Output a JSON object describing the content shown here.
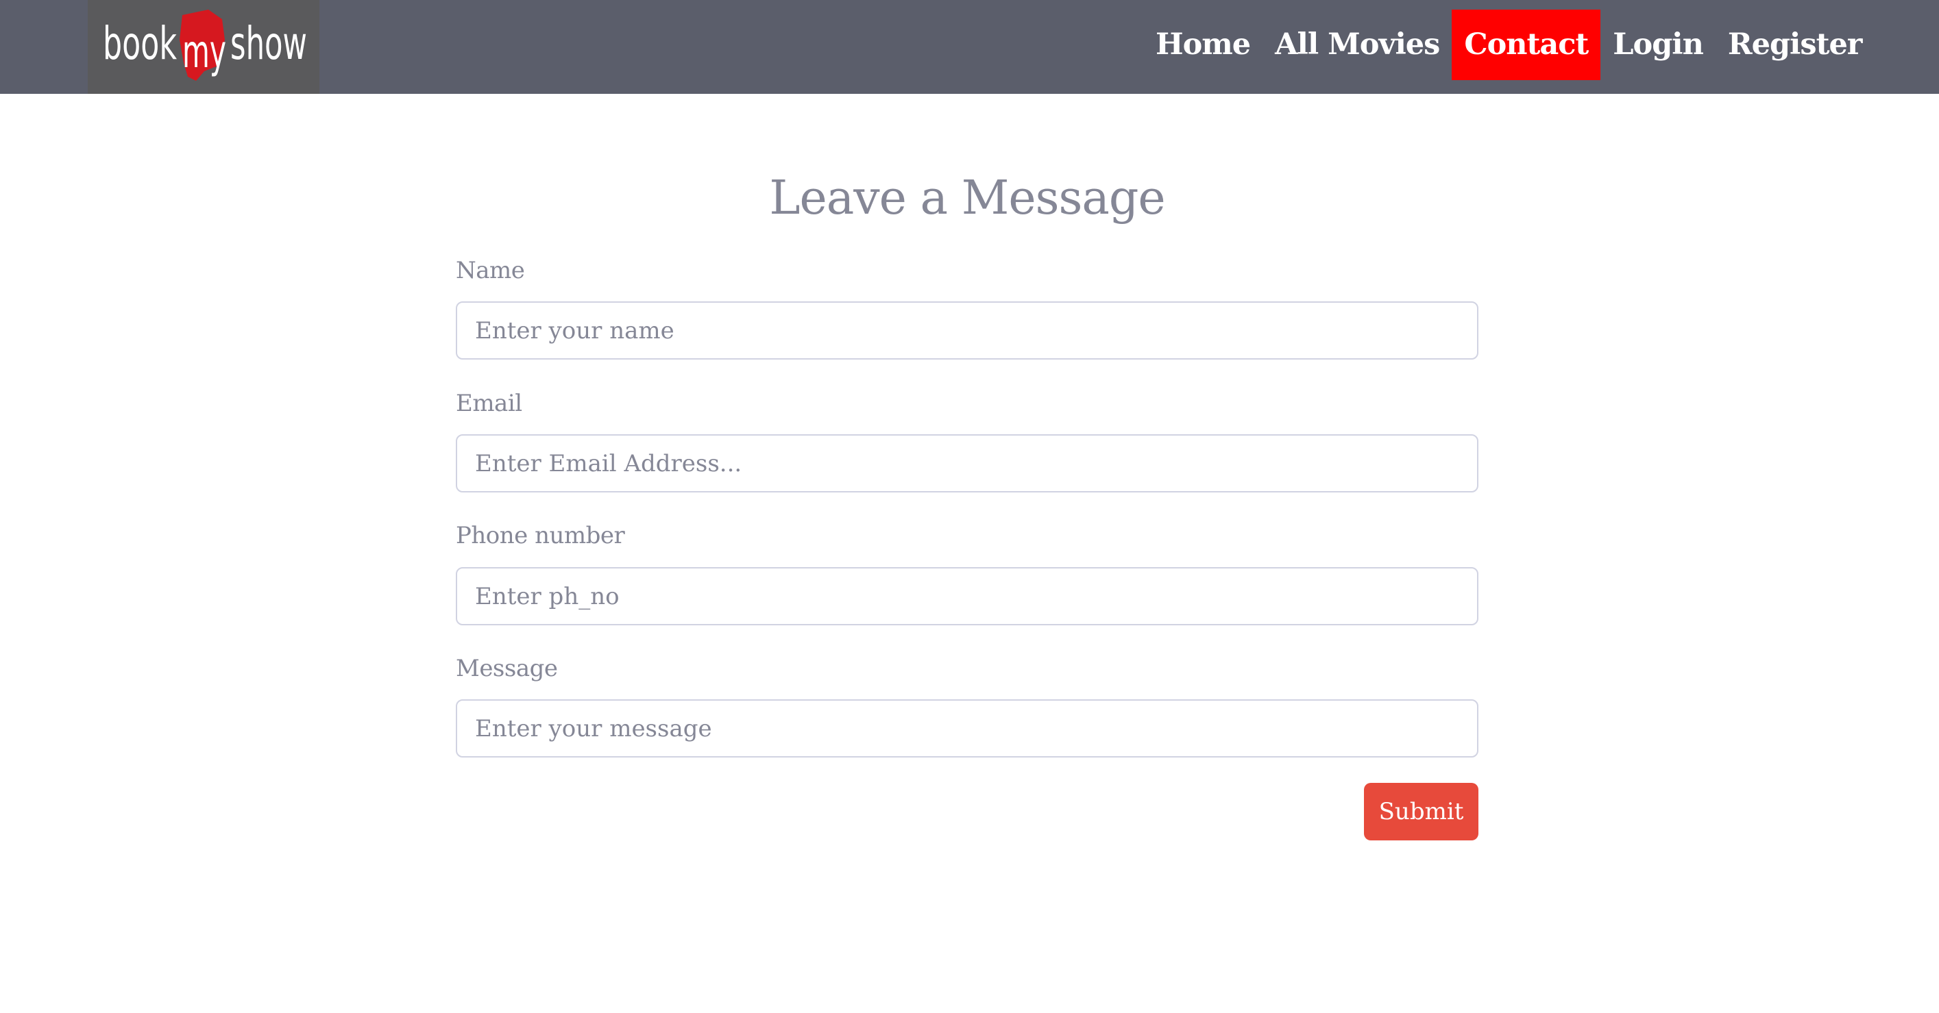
{
  "brand": {
    "logo_text_left": "book",
    "logo_text_middle": "my",
    "logo_text_right": "show",
    "logo_accent_color": "#d6181f"
  },
  "nav": {
    "items": [
      {
        "label": "Home",
        "active": false
      },
      {
        "label": "All Movies",
        "active": false
      },
      {
        "label": "Contact",
        "active": true
      },
      {
        "label": "Login",
        "active": false
      },
      {
        "label": "Register",
        "active": false
      }
    ],
    "active_color": "#ff0000",
    "bar_color": "#5b5e6b"
  },
  "form": {
    "title": "Leave a Message",
    "fields": [
      {
        "label": "Name",
        "placeholder": "Enter your name",
        "value": ""
      },
      {
        "label": "Email",
        "placeholder": "Enter Email Address...",
        "value": ""
      },
      {
        "label": "Phone number",
        "placeholder": "Enter ph_no",
        "value": ""
      },
      {
        "label": "Message",
        "placeholder": "Enter your message",
        "value": ""
      }
    ],
    "submit_label": "Submit",
    "submit_color": "#e74a3b"
  }
}
